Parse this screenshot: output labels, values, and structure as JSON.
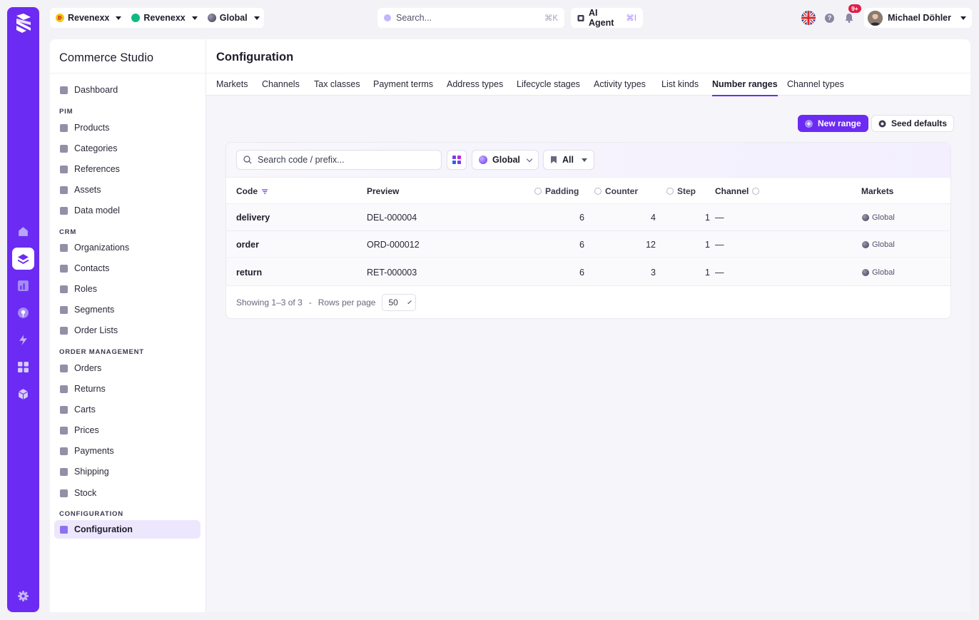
{
  "topbar": {
    "org_selector": "Revenexx",
    "store_selector": "Revenexx",
    "scope_selector": "Global",
    "search_placeholder": "Search...",
    "search_shortcut": "⌘K",
    "ai_label": "AI Agent",
    "ai_shortcut": "⌘I",
    "notifications_badge": "9+",
    "user_name": "Michael Döhler",
    "help_glyph": "?"
  },
  "sidebar": {
    "title": "Commerce Studio",
    "dashboard": "Dashboard",
    "sections": {
      "pim": "PIM",
      "crm": "CRM",
      "order_management": "ORDER MANAGEMENT",
      "configuration": "CONFIGURATION"
    },
    "pim_items": [
      "Products",
      "Categories",
      "References",
      "Assets",
      "Data model"
    ],
    "crm_items": [
      "Organizations",
      "Contacts",
      "Roles",
      "Segments",
      "Order Lists"
    ],
    "om_items": [
      "Orders",
      "Returns",
      "Carts",
      "Prices",
      "Payments",
      "Shipping",
      "Stock"
    ],
    "config_items": [
      "Configuration"
    ]
  },
  "main": {
    "title": "Configuration",
    "tabs": [
      "Markets",
      "Channels",
      "Tax classes",
      "Payment terms",
      "Address types",
      "Lifecycle stages",
      "Activity types",
      "List kinds",
      "Number ranges",
      "Channel types"
    ],
    "active_tab": "Number ranges",
    "new_button": "New range",
    "seed_button": "Seed defaults",
    "filters": {
      "search_placeholder": "Search code / prefix...",
      "scope": "Global",
      "status": "All"
    },
    "columns": {
      "code": "Code",
      "preview": "Preview",
      "padding": "Padding",
      "counter": "Counter",
      "step": "Step",
      "channel": "Channel",
      "markets": "Markets"
    },
    "rows": [
      {
        "code": "delivery",
        "preview": "DEL-000004",
        "padding": "6",
        "counter": "4",
        "step": "1",
        "channel": "—",
        "markets": "Global"
      },
      {
        "code": "order",
        "preview": "ORD-000012",
        "padding": "6",
        "counter": "12",
        "step": "1",
        "channel": "—",
        "markets": "Global"
      },
      {
        "code": "return",
        "preview": "RET-000003",
        "padding": "6",
        "counter": "3",
        "step": "1",
        "channel": "—",
        "markets": "Global"
      }
    ],
    "footer": {
      "showing": "Showing 1–3 of 3",
      "separator": "-",
      "rows_per_page_label": "Rows per page",
      "rows_per_page": "50"
    }
  },
  "colors": {
    "accent": "#6c2bf2",
    "active_bg": "#ede7fd",
    "badge": "#e11d48"
  }
}
